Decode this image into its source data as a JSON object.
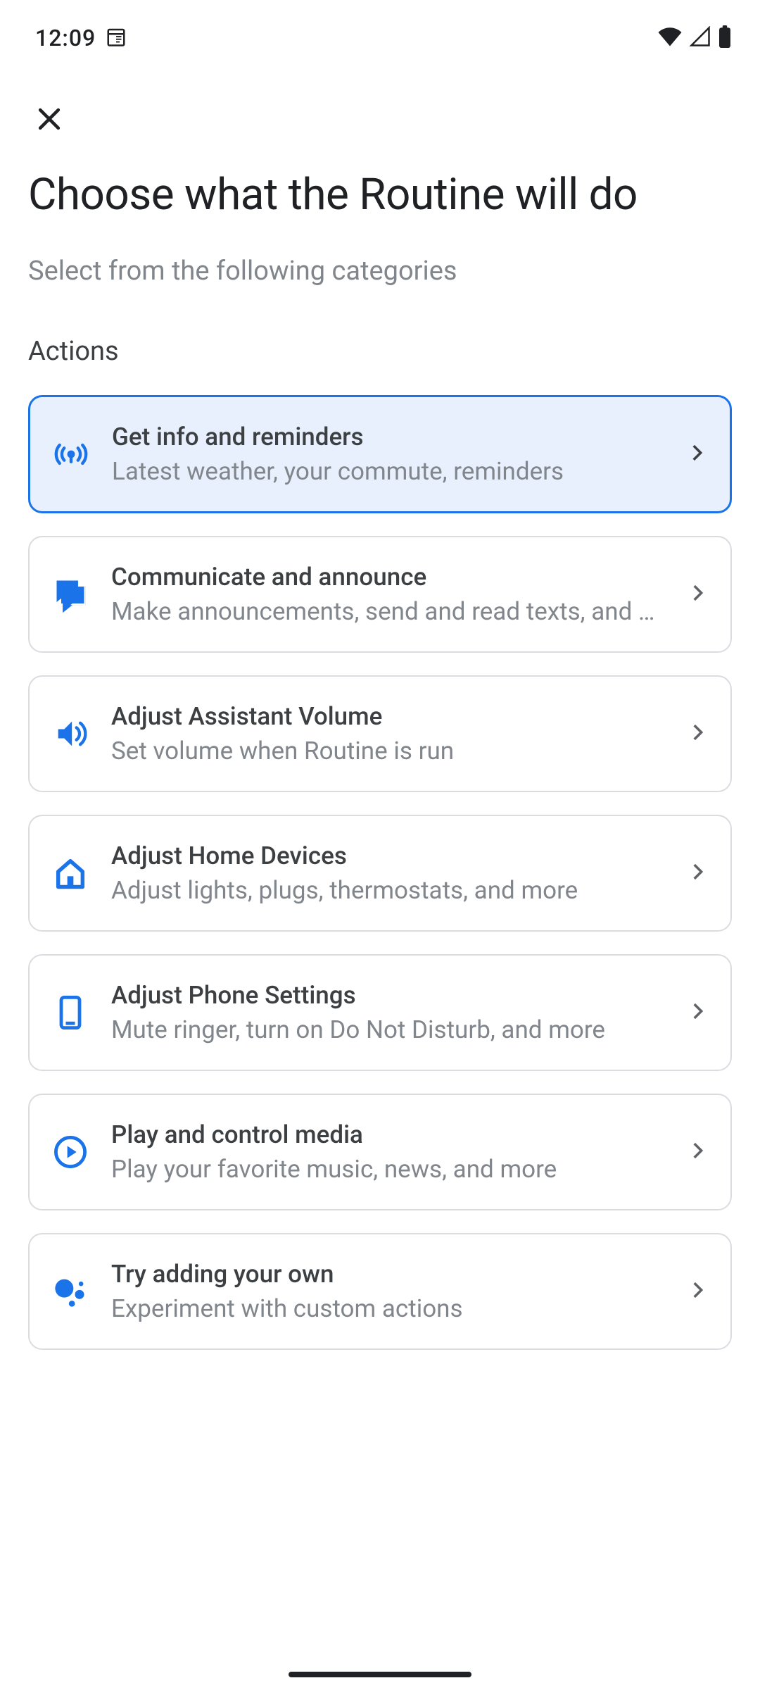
{
  "status": {
    "time": "12:09"
  },
  "header": {
    "title": "Choose what the Routine will do",
    "subtitle": "Select from the following categories",
    "section": "Actions"
  },
  "actions": [
    {
      "title": "Get info and reminders",
      "subtitle": "Latest weather, your commute, reminders"
    },
    {
      "title": "Communicate and announce",
      "subtitle": "Make announcements, send and read texts, and more"
    },
    {
      "title": "Adjust Assistant Volume",
      "subtitle": "Set volume when Routine is run"
    },
    {
      "title": "Adjust Home Devices",
      "subtitle": "Adjust lights, plugs, thermostats, and more"
    },
    {
      "title": "Adjust Phone Settings",
      "subtitle": "Mute ringer, turn on Do Not Disturb, and more"
    },
    {
      "title": "Play and control media",
      "subtitle": "Play your favorite music, news, and more"
    },
    {
      "title": "Try adding your own",
      "subtitle": "Experiment with custom actions"
    }
  ],
  "colors": {
    "accent": "#1a73e8",
    "icon": "#1a73e8"
  }
}
